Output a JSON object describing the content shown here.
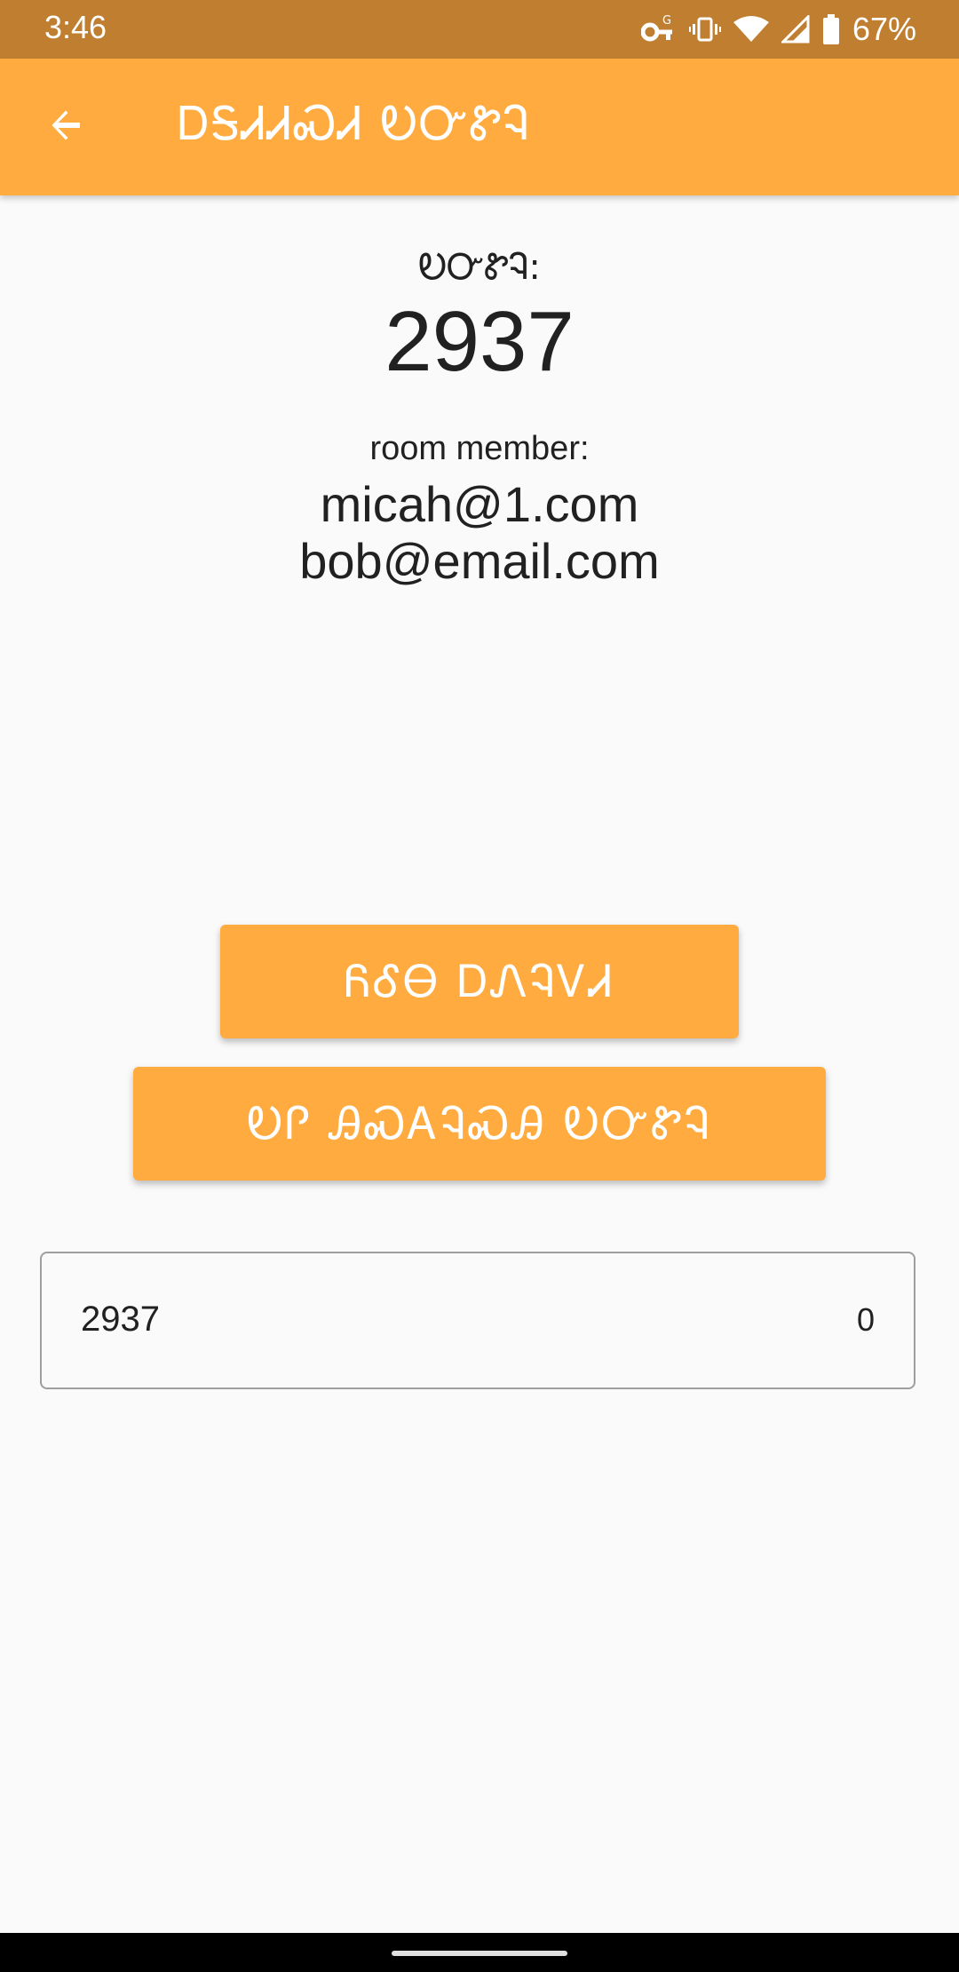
{
  "status_bar": {
    "time": "3:46",
    "battery_percent": "67%",
    "icons": [
      "vpn-key-icon",
      "vibrate-icon",
      "wifi-icon",
      "signal-icon",
      "battery-icon"
    ]
  },
  "app_bar": {
    "back_icon": "arrow-back-icon",
    "title": "ᎠᎦᏗᏗᏍᏗ ᎧᏅᏑᎸ"
  },
  "room": {
    "label": "ᎧᏅᏑᎸ:",
    "code": "2937"
  },
  "members": {
    "label": "room member:",
    "list": [
      "micah@1.com",
      "bob@email.com"
    ]
  },
  "buttons": {
    "primary": "ᏲᎴᎾ ᎠᏁᎸᏙᏗ",
    "secondary": "ᎧᎵ ᎯᏍᎪᎸᏍᎯ ᎧᏅᏑᎸ"
  },
  "input": {
    "value": "2937",
    "counter": "0"
  },
  "colors": {
    "accent": "#ffab40",
    "status_bar": "#c07f30",
    "background": "#fafafa"
  }
}
